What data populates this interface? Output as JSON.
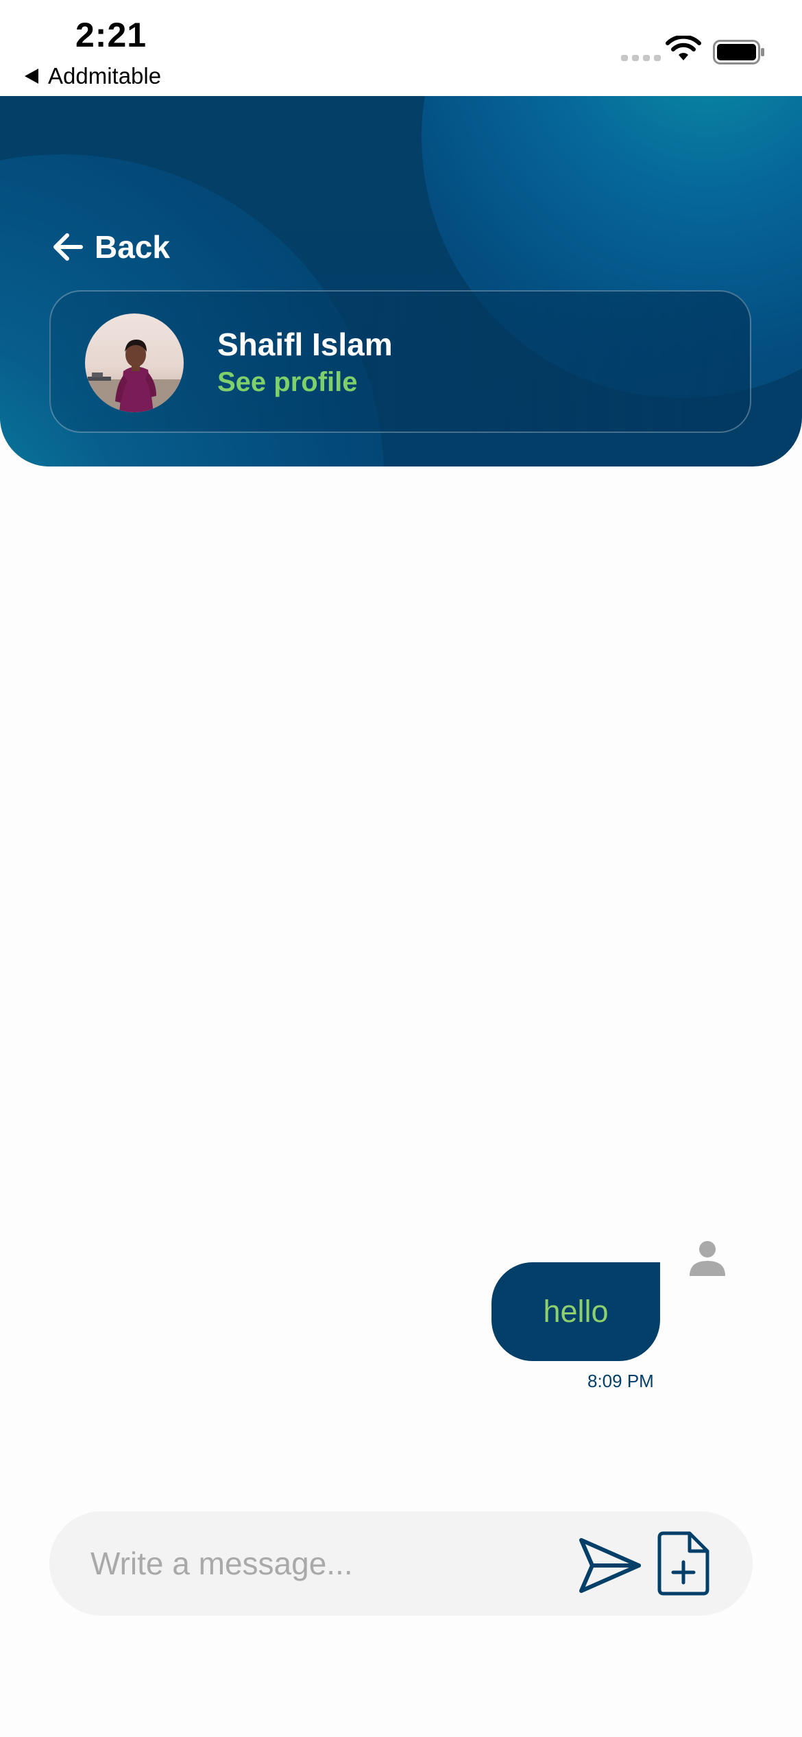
{
  "status_bar": {
    "time": "2:21",
    "back_app_label": "Addmitable",
    "icons": [
      "cellular-signal-icon",
      "wifi-icon",
      "battery-icon"
    ]
  },
  "header": {
    "back_label": "Back",
    "contact": {
      "name": "Shaifl Islam",
      "see_profile_label": "See profile",
      "avatar": "contact-photo"
    }
  },
  "messages": [
    {
      "text": "hello",
      "time": "8:09 PM",
      "direction": "outgoing",
      "sender_icon": "person-icon"
    }
  ],
  "composer": {
    "placeholder": "Write a message...",
    "value": "",
    "send_icon": "send-icon",
    "attach_icon": "attach-file-icon"
  },
  "colors": {
    "primary": "#033f68",
    "accent": "#7fd06a",
    "teal": "#0a8ea4",
    "composer_bg": "#f3f3f3",
    "placeholder": "#a9a9a9"
  }
}
